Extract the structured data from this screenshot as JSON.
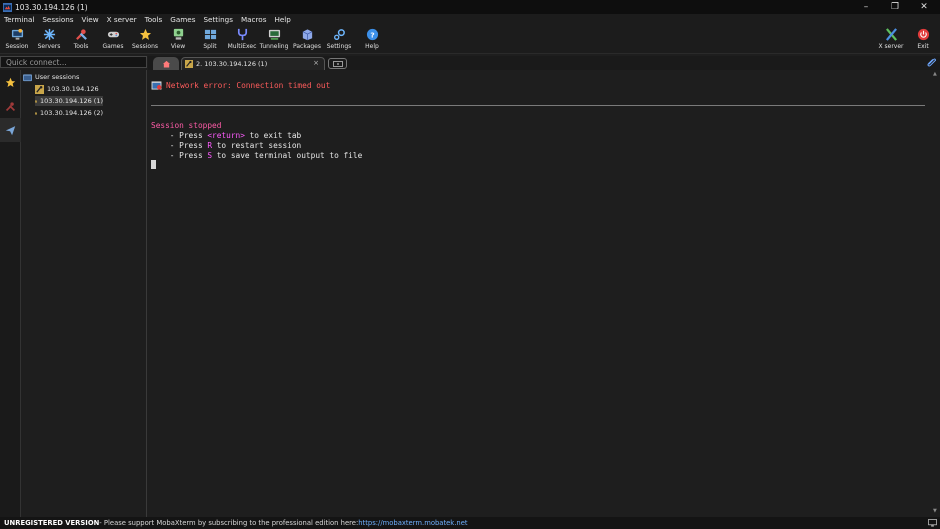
{
  "window": {
    "title": "103.30.194.126 (1)",
    "minimize": "–",
    "restore": "❐",
    "close": "✕"
  },
  "menu": [
    "Terminal",
    "Sessions",
    "View",
    "X server",
    "Tools",
    "Games",
    "Settings",
    "Macros",
    "Help"
  ],
  "toolbar": {
    "session": "Session",
    "servers": "Servers",
    "tools": "Tools",
    "games": "Games",
    "sessions": "Sessions",
    "view": "View",
    "split": "Split",
    "multiexec": "MultiExec",
    "tunneling": "Tunneling",
    "packages": "Packages",
    "settings": "Settings",
    "help": "Help",
    "xserver": "X server",
    "exit": "Exit"
  },
  "sidebar": {
    "search_placeholder": "Quick connect...",
    "root": "User sessions",
    "items": [
      "103.30.194.126",
      "103.30.194.126 (1)",
      "103.30.194.126 (2)"
    ],
    "selected_index": 1
  },
  "tabs": {
    "session_tab_label": "2. 103.30.194.126 (1)",
    "close": "×"
  },
  "terminal": {
    "error_line": "Network error: Connection timed out",
    "stopped": "Session stopped",
    "l1_a": "    - Press ",
    "l1_key": "<return>",
    "l1_b": " to exit tab",
    "l2_a": "    - Press ",
    "l2_key": "R",
    "l2_b": " to restart session",
    "l3_a": "    - Press ",
    "l3_key": "S",
    "l3_b": " to save terminal output to file"
  },
  "status": {
    "unregistered": "UNREGISTERED VERSION",
    "message": "  -  Please support MobaXterm by subscribing to the professional edition here:  ",
    "link": "https://mobaxterm.mobatek.net"
  },
  "colors": {
    "error": "#ff5c5c",
    "stopped": "#ff5ca8",
    "key": "#ff5cff",
    "link": "#6fb1ff"
  }
}
